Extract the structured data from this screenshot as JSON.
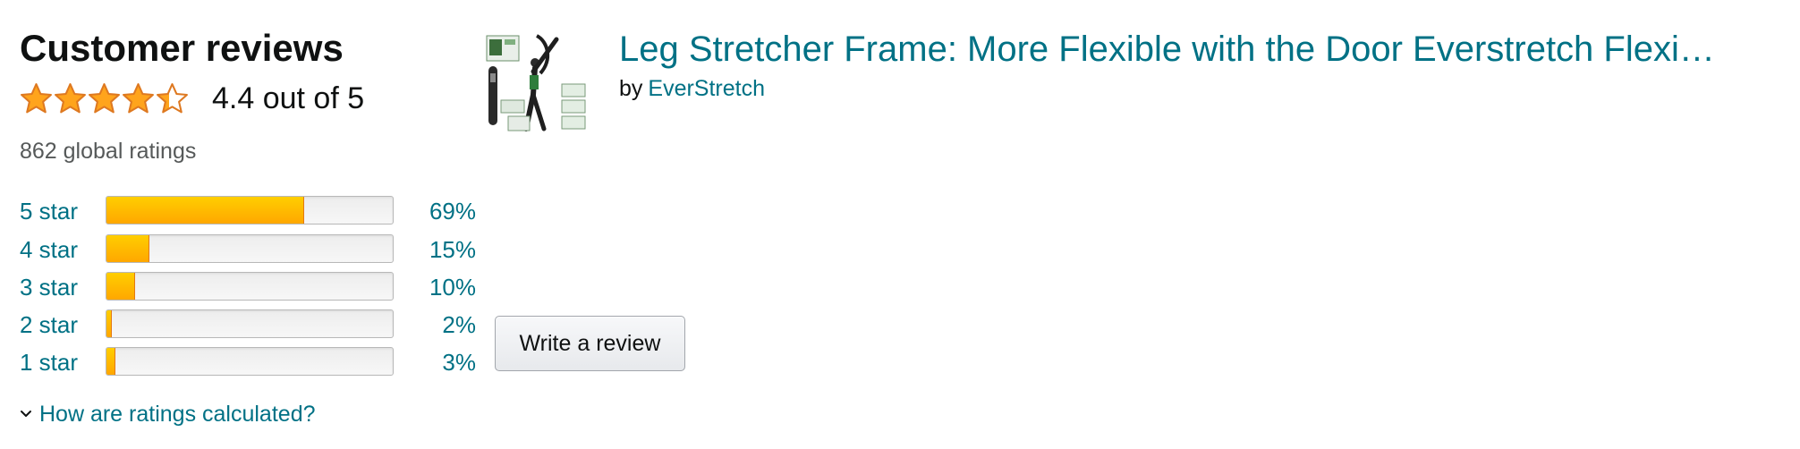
{
  "header": {
    "title": "Customer reviews"
  },
  "rating": {
    "text": "4.4 out of 5",
    "value": 4.4,
    "max": 5,
    "star_color": "#ffa41c",
    "star_outline": "#de7921"
  },
  "global_ratings": "862 global ratings",
  "histogram": [
    {
      "label": "5 star",
      "percent_label": "69%",
      "percent": 69
    },
    {
      "label": "4 star",
      "percent_label": "15%",
      "percent": 15
    },
    {
      "label": "3 star",
      "percent_label": "10%",
      "percent": 10
    },
    {
      "label": "2 star",
      "percent_label": "2%",
      "percent": 2
    },
    {
      "label": "1 star",
      "percent_label": "3%",
      "percent": 3
    }
  ],
  "how_calculated": "How are ratings calculated?",
  "product": {
    "title": "Leg Stretcher Frame: More Flexible with the Door Everstretch Flexi…",
    "by_label": "by",
    "brand": "EverStretch"
  },
  "write_review_label": "Write a review",
  "colors": {
    "link": "#007185",
    "bar_fill": "#ffa41c",
    "text": "#0f1111",
    "muted": "#565959"
  }
}
